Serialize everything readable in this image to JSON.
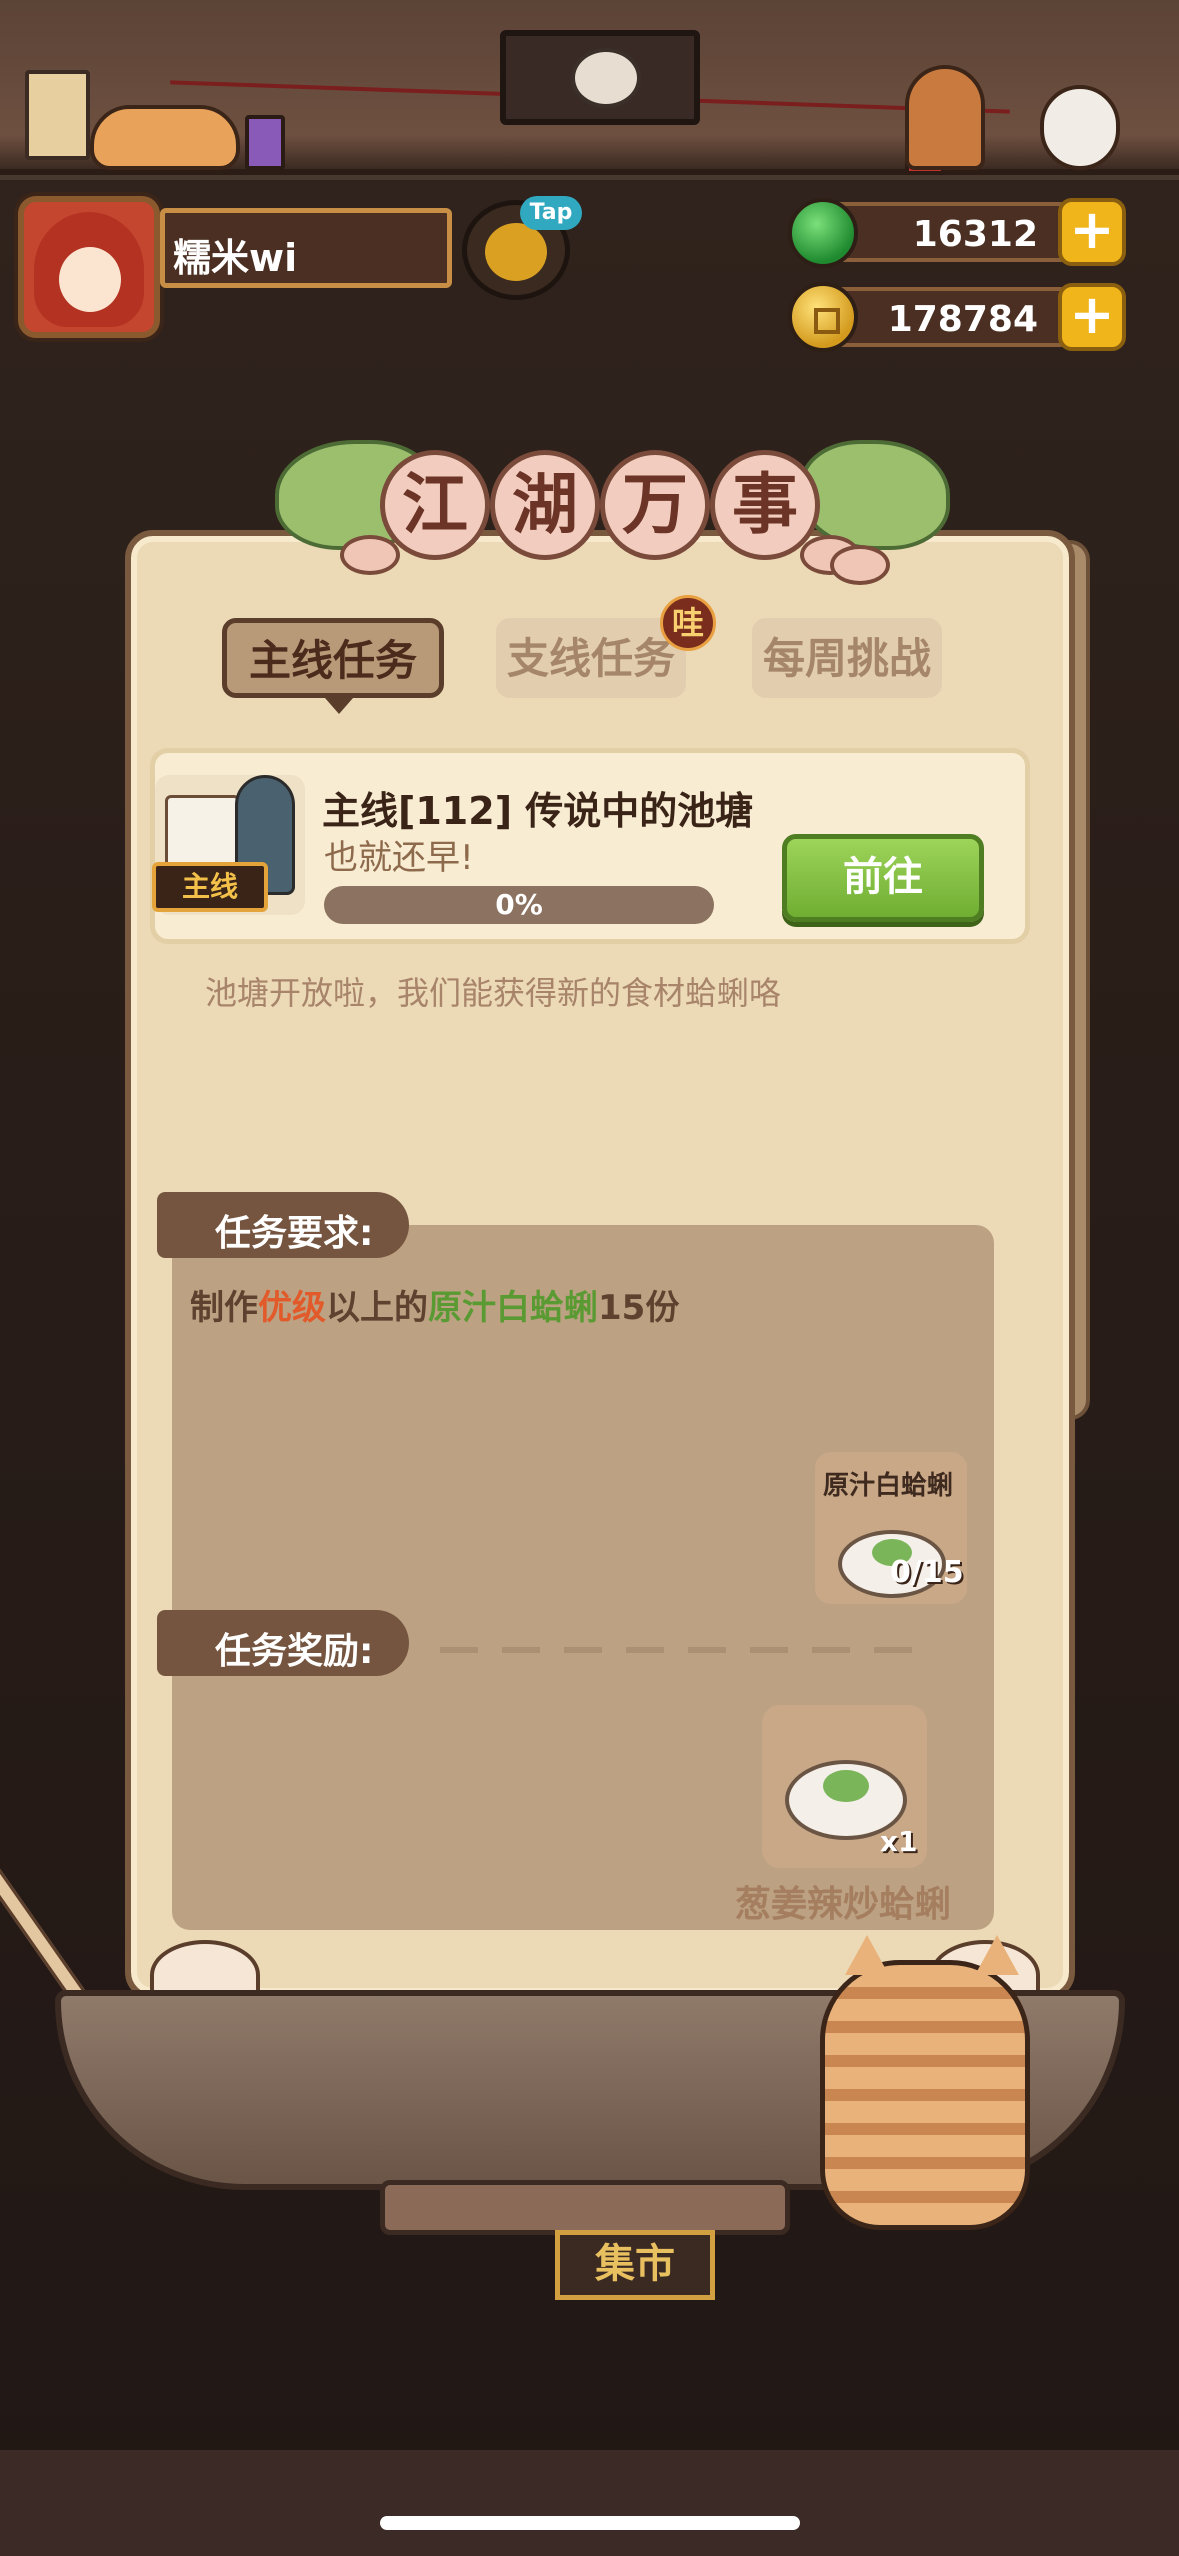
{
  "player": {
    "name": "糯米wi"
  },
  "hud": {
    "tap_label": "Tap",
    "jade": "16312",
    "coins": "178784",
    "plus": "+"
  },
  "dialog": {
    "title_chars": [
      "江",
      "湖",
      "万",
      "事"
    ],
    "tabs": [
      {
        "label": "主线任务",
        "active": true
      },
      {
        "label": "支线任务",
        "active": false,
        "badge": "哇"
      },
      {
        "label": "每周挑战",
        "active": false
      }
    ],
    "quest": {
      "tag": "主线",
      "title": "主线[112]  传说中的池塘",
      "subtitle": "也就还早!",
      "progress_text": "0%",
      "progress": 0,
      "go_button": "前往",
      "description": "池塘开放啦，我们能获得新的食材蛤蜊咯"
    },
    "requirements": {
      "heading": "任务要求:",
      "text_prefix": "制作",
      "text_quality": "优级",
      "text_mid": "以上的",
      "text_dish": "原汁白蛤蜊",
      "text_suffix": "15份",
      "item": {
        "name": "原汁白蛤蜊",
        "count": "0/15"
      }
    },
    "rewards": {
      "heading": "任务奖励:",
      "item": {
        "name": "葱姜辣炒蛤蜊",
        "qty": "x1"
      }
    }
  },
  "background": {
    "market_sign": "集市"
  },
  "colors": {
    "accent_green": "#6fae32",
    "highlight_red": "#e25a2a",
    "highlight_green": "#5a9a32",
    "panel": "#ecd9b6"
  }
}
